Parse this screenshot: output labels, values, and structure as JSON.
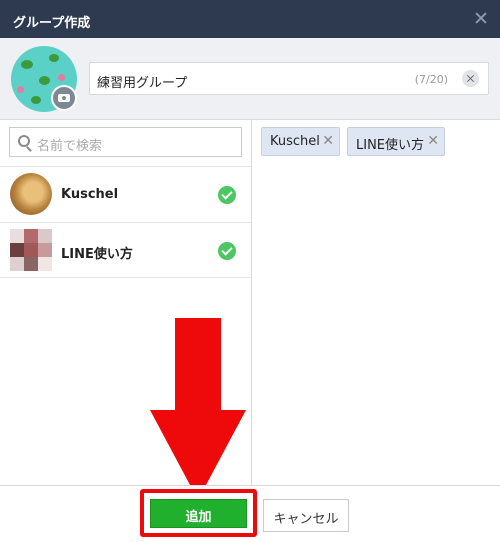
{
  "window": {
    "title": "グループ作成"
  },
  "group": {
    "name": "練習用グループ",
    "char_count": "(7/20)"
  },
  "search": {
    "placeholder": "名前で検索"
  },
  "friends": [
    {
      "name": "Kuschel",
      "selected": true
    },
    {
      "name": "LINE使い方",
      "selected": true
    }
  ],
  "selected_chips": [
    {
      "label": "Kuschel"
    },
    {
      "label": "LINE使い方"
    }
  ],
  "buttons": {
    "add": "追加",
    "cancel": "キャンセル"
  },
  "colors": {
    "titlebar": "#2e3a4f",
    "add_button": "#20b02d",
    "check": "#4cc764",
    "highlight_annotation": "#ee0a0a",
    "chip_background": "#dfe6f3"
  }
}
